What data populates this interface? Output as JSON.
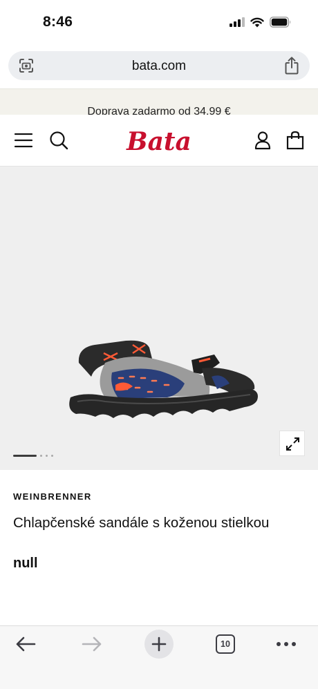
{
  "status_bar": {
    "time": "8:46",
    "icons": [
      "signal-icon",
      "wifi-icon",
      "battery-icon"
    ]
  },
  "browser": {
    "url": "bata.com",
    "left_icon": "page-settings-icon",
    "share_icon": "share-icon"
  },
  "promo": {
    "text": "Doprava zadarmo od 34,99 €"
  },
  "header": {
    "logo": "Bata",
    "icons": [
      "menu-icon",
      "search-icon",
      "account-icon",
      "bag-icon"
    ],
    "brand_color": "#c8102e"
  },
  "gallery": {
    "image": "boys-sandal",
    "slide_current": 1,
    "slide_count": 3,
    "expand_icon": "expand-icon"
  },
  "product": {
    "brand": "WEINBRENNER",
    "title": "Chlapčenské sandále s koženou stielkou",
    "price": "null"
  },
  "toolbar": {
    "tabs_count": "10",
    "icons": [
      "back-icon",
      "forward-icon",
      "new-tab-icon",
      "tabs-icon",
      "more-icon"
    ]
  }
}
